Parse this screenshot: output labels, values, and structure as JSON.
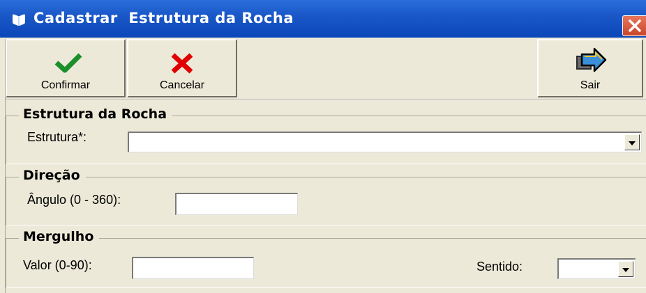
{
  "window": {
    "title": "Cadastrar  Estrutura da Rocha"
  },
  "toolbar": {
    "confirmar_label": "Confirmar",
    "cancelar_label": "Cancelar",
    "sair_label": "Sair"
  },
  "groups": {
    "estrutura": {
      "title": "Estrutura da Rocha",
      "field_label": "Estrutura*:",
      "value": ""
    },
    "direcao": {
      "title": "Direção",
      "field_label": "Ângulo (0 - 360):",
      "value": ""
    },
    "mergulho": {
      "title": "Mergulho",
      "valor_label": "Valor (0-90):",
      "valor_value": "",
      "sentido_label": "Sentido:",
      "sentido_value": ""
    }
  },
  "colors": {
    "titlebar": "#0b47b8",
    "confirm_check": "#1a8f2a",
    "cancel_x": "#e00000",
    "exit_arrow": "#3a8fd8",
    "face": "#ece9d8"
  },
  "icons": {
    "title": "app-icon",
    "close": "close-icon",
    "confirm": "check-icon",
    "cancel": "x-icon",
    "exit": "exit-arrow-icon"
  }
}
